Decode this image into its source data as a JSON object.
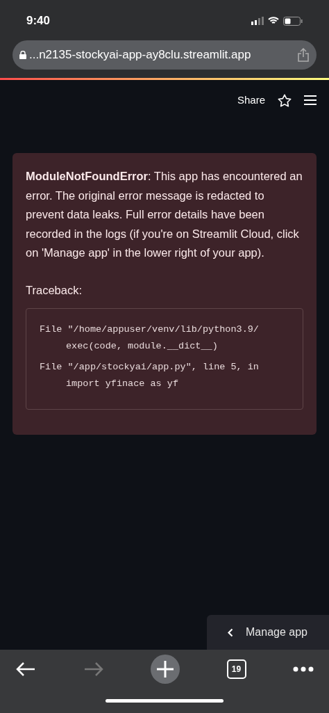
{
  "status_bar": {
    "time": "9:40"
  },
  "address_bar": {
    "url": "...n2135-stockyai-app-ay8clu.streamlit.app"
  },
  "app_header": {
    "share": "Share"
  },
  "error": {
    "message": "**ModuleNotFoundError**: This app has encountered an error. The original error message is redacted to prevent data leaks. Full error details have been recorded in the logs (if you're on Streamlit Cloud, click on 'Manage app' in the lower right of your app).",
    "traceback_label": "Traceback:",
    "traceback_lines": [
      {
        "kind": "file",
        "text": "File \"/home/appuser/venv/lib/python3.9/"
      },
      {
        "kind": "code",
        "text": "exec(code, module.__dict__)"
      },
      {
        "kind": "file",
        "text": "File \"/app/stockyai/app.py\", line 5, in"
      },
      {
        "kind": "code",
        "text": "import yfinace as yf"
      }
    ]
  },
  "manage_app": {
    "label": "Manage app"
  },
  "toolbar": {
    "back_disabled": false,
    "forward_disabled": true,
    "tab_count": "19"
  }
}
